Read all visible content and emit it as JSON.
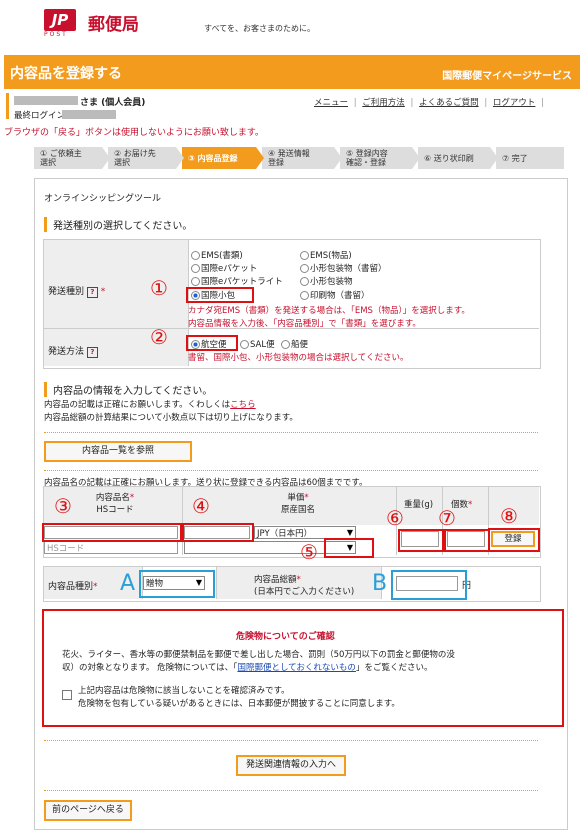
{
  "header": {
    "logo_mark": "JP",
    "logo_sub": "POST",
    "logo_text": "郵便局",
    "tagline": "すべてを、お客さまのために。"
  },
  "titlebar": {
    "title": "内容品を登録する",
    "service": "国際郵便マイページサービス"
  },
  "user": {
    "suffix": "さま (個人会員)",
    "last_login": "最終ログイン時刻 :",
    "links": [
      "メニュー",
      "ご利用方法",
      "よくあるご質問",
      "ログアウト"
    ]
  },
  "warning": "ブラウザの「戻る」ボタンは使用しないようにお願い致します。",
  "steps": [
    {
      "l1": "① ご依頼主",
      "l2": "選択"
    },
    {
      "l1": "② お届け先",
      "l2": "選択"
    },
    {
      "l1": "③ 内容品登録",
      "l2": ""
    },
    {
      "l1": "④ 発送情報",
      "l2": "登録"
    },
    {
      "l1": "⑤ 登録内容",
      "l2": "確認・登録"
    },
    {
      "l1": "⑥ 送り状印刷",
      "l2": ""
    },
    {
      "l1": "⑦ 完了",
      "l2": ""
    }
  ],
  "panel_title": "オンラインシッピングツール",
  "section1": "発送種別の選択してください。",
  "shipping_type": {
    "label": "発送種別",
    "required": "*",
    "options": [
      "EMS(書類)",
      "EMS(物品)",
      "国際eパケット",
      "小形包装物（書留）",
      "国際eパケットライト",
      "小形包装物",
      "国際小包",
      "印刷物（書留）"
    ],
    "selected": "国際小包",
    "note1": "カナダ宛EMS（書類）を発送する場合は、「EMS（物品）」を選択します。",
    "note2": "内容品情報を入力後、「内容品種別」で「書類」を選びます。"
  },
  "ship_method": {
    "label": "発送方法",
    "options": [
      "航空便",
      "SAL便",
      "船便"
    ],
    "selected": "航空便",
    "note": "書留、国際小包、小形包装物の場合は選択してください。"
  },
  "section2": "内容品の情報を入力してください。",
  "info1_a": "内容品の記載は正確にお願いします。くわしくは",
  "info1_link": "こちら",
  "info2": "内容品総額の計算結果について小数点以下は切り上げになります。",
  "browse_button": "内容品一覧を参照",
  "items_note": "内容品名の記載は正確にお願いします。送り状に登録できる内容品は60個までです。",
  "items_table": {
    "col1a": "内容品名",
    "col1b": "HSコード",
    "col2a": "単価",
    "col2b": "原産国名",
    "col3": "重量(g)",
    "col4": "個数",
    "req": "*",
    "hs_placeholder": "HSコード",
    "currency": "JPY（日本円）",
    "register": "登録"
  },
  "category": {
    "label": "内容品種別",
    "req": "*",
    "value": "贈物",
    "total_label1": "内容品総額",
    "total_label2": "(日本円でご入力ください)",
    "yen": "円"
  },
  "danger": {
    "title": "危険物についてのご確認",
    "text1": "花火、ライター、香水等の郵便禁制品を郵便で差し出した場合、罰則（50万円以下の罰金と郵便物の没",
    "text2a": "収）の対象となります。 危険物については、「",
    "text2link": "国際郵便としておくれないもの",
    "text2b": "」をご覧ください。",
    "check1": "上記内容品は危険物に該当しないことを確認済みです。",
    "check2": "危険物を包有している疑いがあるときには、日本郵便が開披することに同意します。"
  },
  "next_button": "発送関連情報の入力へ",
  "back_button": "前のページへ戻る",
  "annotations": {
    "red": [
      "①",
      "②",
      "③",
      "④",
      "⑤",
      "⑥",
      "⑦",
      "⑧"
    ],
    "blue": [
      "A",
      "B"
    ]
  }
}
